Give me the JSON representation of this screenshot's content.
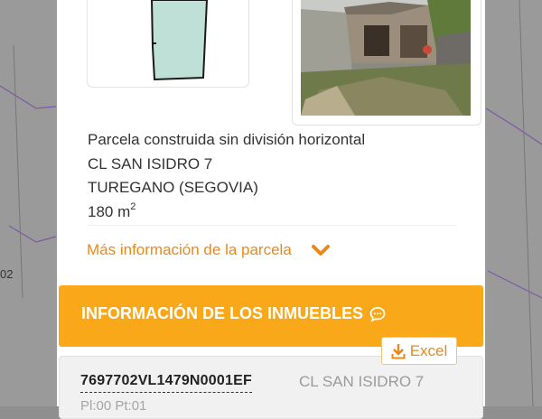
{
  "map": {
    "edge_label": "02"
  },
  "parcel": {
    "type": "Parcela construida sin división horizontal",
    "address": "CL SAN ISIDRO 7",
    "town": "TUREGANO (SEGOVIA)",
    "area_value": "180 m",
    "area_unit_exp": "2",
    "more_info_label": "Más información de la parcela"
  },
  "inmuebles": {
    "title": "INFORMACIÓN DE LOS INMUEBLES",
    "excel_label": "Excel",
    "items": [
      {
        "ref": "7697702VL1479N0001EF",
        "address": "CL SAN ISIDRO 7",
        "detail": "Pl:00 Pt:01"
      }
    ]
  },
  "colors": {
    "accent": "#e8891c",
    "header_bg": "#f9a81a",
    "parcel_fill": "#bfe0d6"
  },
  "icons": [
    "chevron-down-icon",
    "chat-bubble-icon",
    "download-icon"
  ]
}
